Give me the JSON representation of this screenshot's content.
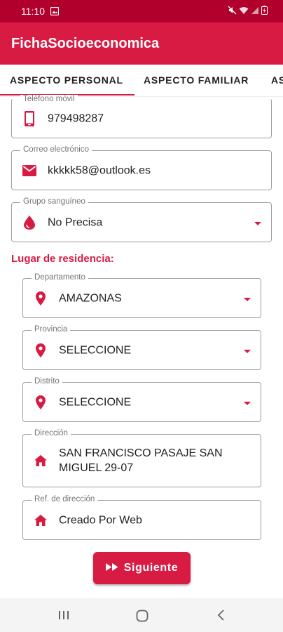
{
  "status_bar": {
    "time": "11:10"
  },
  "app": {
    "title": "FichaSocioeconomica"
  },
  "tabs": [
    {
      "label": "ASPECTO PERSONAL"
    },
    {
      "label": "ASPECTO FAMILIAR"
    },
    {
      "label": "AS"
    }
  ],
  "form": {
    "phone": {
      "label": "Teléfono móvil",
      "value": "979498287",
      "icon": "phone-icon"
    },
    "email": {
      "label": "Correo electrónico",
      "value": "kkkkk58@outlook.es",
      "icon": "email-icon"
    },
    "blood": {
      "label": "Grupo sanguíneo",
      "value": "No Precisa",
      "icon": "blood-drop-icon"
    }
  },
  "residence": {
    "title": "Lugar de residencia:",
    "department": {
      "label": "Departamento",
      "value": "AMAZONAS",
      "icon": "location-pin-icon"
    },
    "province": {
      "label": "Provincia",
      "value": "SELECCIONE",
      "icon": "location-pin-icon"
    },
    "district": {
      "label": "Distrito",
      "value": "SELECCIONE",
      "icon": "location-pin-icon"
    },
    "address": {
      "label": "Dirección",
      "value": "SAN FRANCISCO PASAJE SAN MIGUEL 29-07",
      "icon": "home-icon"
    },
    "address_ref": {
      "label": "Ref. de dirección",
      "value": "Creado Por Web",
      "icon": "home-icon"
    }
  },
  "actions": {
    "next_label": "Siguiente"
  },
  "colors": {
    "primary": "#d81b43",
    "status_bar": "#b0002b"
  }
}
